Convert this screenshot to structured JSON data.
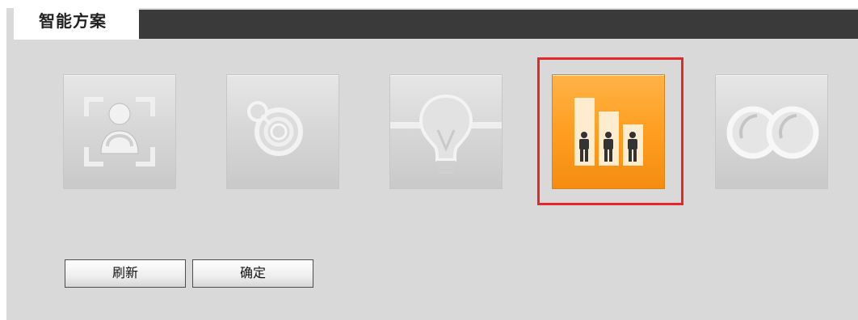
{
  "header": {
    "title": "智能方案"
  },
  "tiles": [
    {
      "icon": "face-recognition-icon",
      "selected": false
    },
    {
      "icon": "camera-lens-icon",
      "selected": false
    },
    {
      "icon": "lightbulb-icon",
      "selected": false
    },
    {
      "icon": "people-counting-icon",
      "selected": true
    },
    {
      "icon": "dual-lens-icon",
      "selected": false
    }
  ],
  "buttons": {
    "refresh_label": "刷新",
    "confirm_label": "确定"
  },
  "colors": {
    "selected_tile": "#ff9f22",
    "highlight_border": "#e62928",
    "header_bar": "#3a3a3a",
    "panel_background": "#d9d9d9"
  }
}
